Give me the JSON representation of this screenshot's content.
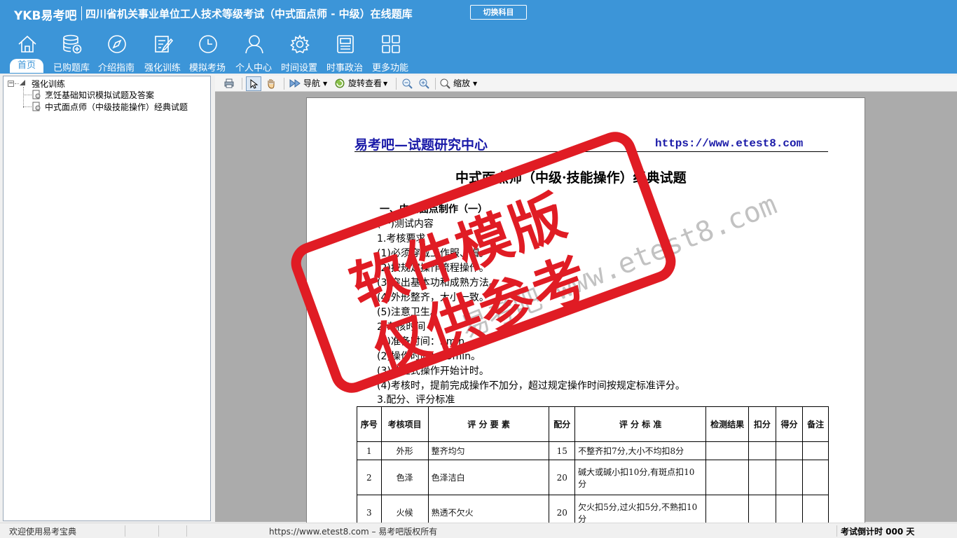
{
  "app": {
    "logo": "YKB易考吧",
    "title": "四川省机关事业单位工人技术等级考试（中式面点师 - 中级）在线题库",
    "switch_button": "切换科目"
  },
  "nav": {
    "items": [
      {
        "label": "首页",
        "icon": "home-icon"
      },
      {
        "label": "已购题库",
        "icon": "database-icon"
      },
      {
        "label": "介绍指南",
        "icon": "compass-icon"
      },
      {
        "label": "强化训练",
        "icon": "edit-icon"
      },
      {
        "label": "模拟考场",
        "icon": "clock-icon"
      },
      {
        "label": "个人中心",
        "icon": "user-icon"
      },
      {
        "label": "时间设置",
        "icon": "gear-icon"
      },
      {
        "label": "时事政治",
        "icon": "news-icon"
      },
      {
        "label": "更多功能",
        "icon": "grid-icon"
      }
    ]
  },
  "tree": {
    "root": "强化训练",
    "children": [
      "烹饪基础知识模拟试题及答案",
      "中式面点师（中级技能操作）经典试题"
    ]
  },
  "toolbar": {
    "nav_label": "导航",
    "rotate_label": "旋转查看",
    "zoom_label": "缩放"
  },
  "document": {
    "header_left": "易考吧—试题研究中心",
    "header_right": "https://www.etest8.com",
    "title": "中式面点师（中级·技能操作）经典试题",
    "lines": [
      "一、中式面点制作（一）",
      "(一)测试内容",
      "1.考核要求",
      "(1)必须穿戴工作服、帽。",
      "(2)按规定操作流程操作。",
      "(3)突出基本功和成熟方法。",
      "(4)外形整齐，大小一致。",
      "(5)注意卫生。",
      "2.考核时间",
      "(1)准备时间：5min。",
      "(2)操作时间：25min。",
      "(3)从正式操作开始计时。",
      "(4)考核时，提前完成操作不加分，超过规定操作时间按规定标准评分。",
      "3.配分、评分标准"
    ],
    "table": {
      "headers": [
        "序号",
        "考核项目",
        "评 分 要 素",
        "配分",
        "评 分 标 准",
        "检测结果",
        "扣分",
        "得分",
        "备注"
      ],
      "rows": [
        [
          "1",
          "外形",
          "整齐均匀",
          "15",
          "不整齐扣7分,大小不均扣8分",
          "",
          "",
          "",
          ""
        ],
        [
          "2",
          "色泽",
          "色泽洁白",
          "20",
          "碱大或碱小扣10分,有斑点扣10分",
          "",
          "",
          "",
          ""
        ],
        [
          "3",
          "火候",
          "熟透不欠火",
          "20",
          "欠火扣5分,过火扣5分,不熟扣10分",
          "",
          "",
          "",
          ""
        ]
      ]
    },
    "watermark": "易考吧 www.etest8.com",
    "stamp_line1": "软件模版",
    "stamp_line2": "仅供参考"
  },
  "status": {
    "welcome": "欢迎使用易考宝典",
    "copyright": "https://www.etest8.com – 易考吧版权所有",
    "countdown": "考试倒计时 000 天"
  },
  "colors": {
    "header_bg": "#3c95d8",
    "stamp_red": "#e01c24",
    "doc_blue": "#1a1aa8"
  }
}
